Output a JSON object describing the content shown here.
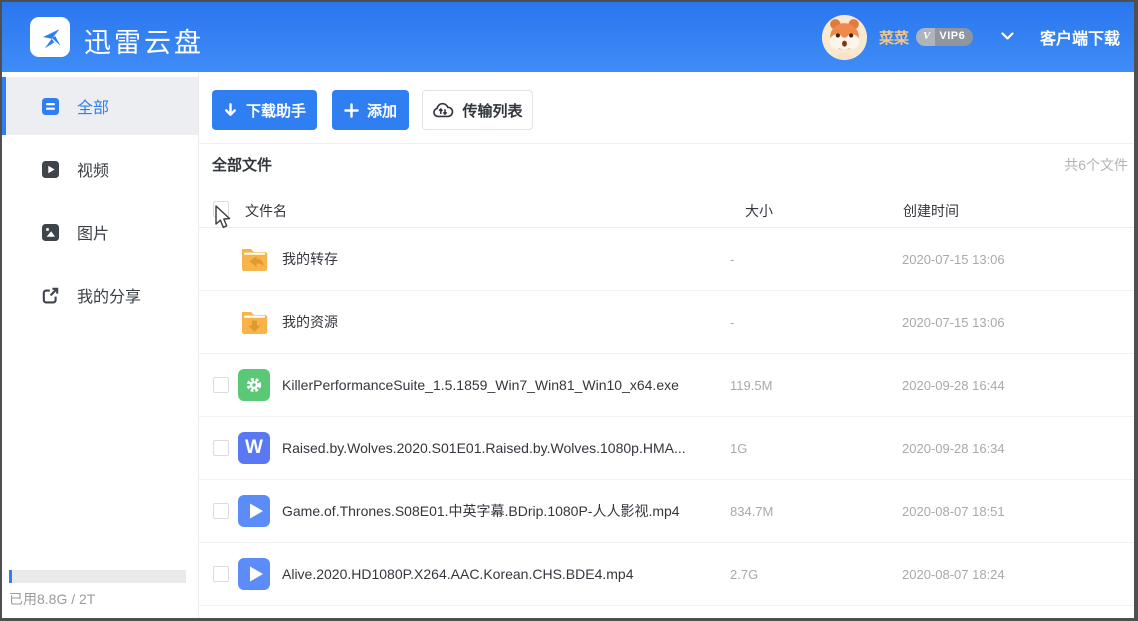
{
  "header": {
    "brand": "迅雷云盘",
    "username": "菜菜",
    "vip_v": "V",
    "vip_level": "VIP6",
    "client_download": "客户端下载"
  },
  "sidebar": {
    "items": [
      {
        "id": "all",
        "label": "全部",
        "active": true
      },
      {
        "id": "video",
        "label": "视频",
        "active": false
      },
      {
        "id": "image",
        "label": "图片",
        "active": false
      },
      {
        "id": "share",
        "label": "我的分享",
        "active": false
      }
    ],
    "storage_text": "已用8.8G / 2T",
    "storage_used_fraction": 0.004
  },
  "toolbar": {
    "download_helper": "下载助手",
    "add": "添加",
    "transfer_list": "传输列表"
  },
  "filelist": {
    "section_title": "全部文件",
    "count_text": "共6个文件",
    "columns": {
      "name": "文件名",
      "size": "大小",
      "created": "创建时间"
    },
    "rows": [
      {
        "name": "我的转存",
        "size": "-",
        "created": "2020-07-15 13:06",
        "type": "folder-transfer",
        "checkbox": false
      },
      {
        "name": "我的资源",
        "size": "-",
        "created": "2020-07-15 13:06",
        "type": "folder-download",
        "checkbox": false
      },
      {
        "name": "KillerPerformanceSuite_1.5.1859_Win7_Win81_Win10_x64.exe",
        "size": "119.5M",
        "created": "2020-09-28 16:44",
        "type": "exe",
        "checkbox": true
      },
      {
        "name": "Raised.by.Wolves.2020.S01E01.Raised.by.Wolves.1080p.HMA...",
        "size": "1G",
        "created": "2020-09-28 16:34",
        "type": "doc-w",
        "checkbox": true
      },
      {
        "name": "Game.of.Thrones.S08E01.中英字幕.BDrip.1080P-人人影视.mp4",
        "size": "834.7M",
        "created": "2020-08-07 18:51",
        "type": "video",
        "checkbox": true
      },
      {
        "name": "Alive.2020.HD1080P.X264.AAC.Korean.CHS.BDE4.mp4",
        "size": "2.7G",
        "created": "2020-08-07 18:24",
        "type": "video",
        "checkbox": true
      }
    ]
  },
  "icons": {
    "doc_w_letter": "W"
  },
  "colors": {
    "accent_blue": "#2f7ff2",
    "header_gradient_top": "#2a76ee",
    "header_gradient_bottom": "#3f8cf7",
    "folder_amber": "#f7b44a",
    "folder_arrow": "#e0992f",
    "exe_green": "#5bc878",
    "doc_blue": "#5b78f3",
    "video_blue": "#5b8cf7",
    "username_gold": "#f0c88a"
  }
}
